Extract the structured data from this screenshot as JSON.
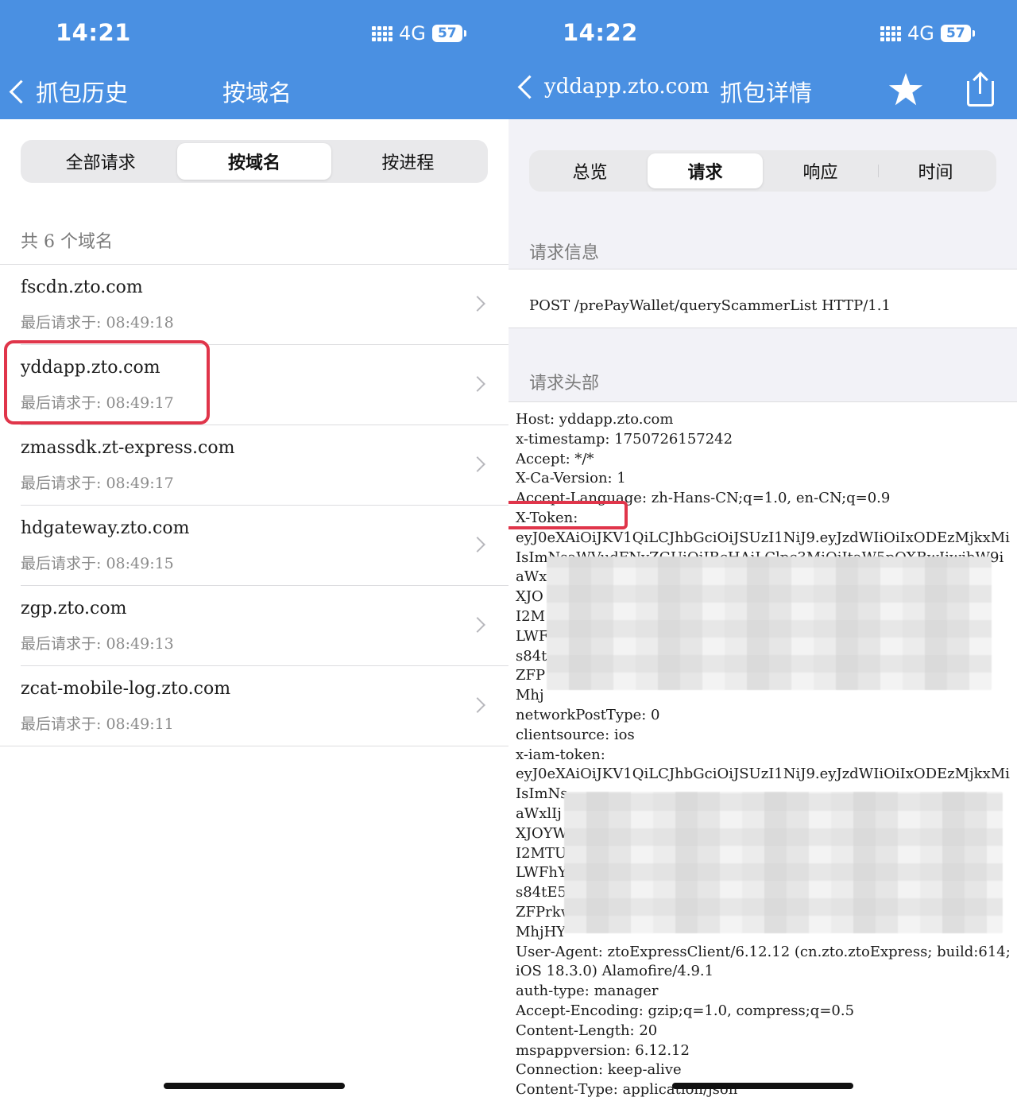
{
  "left": {
    "status": {
      "time": "14:21",
      "network": "4G",
      "battery": "57"
    },
    "nav": {
      "back_label": "抓包历史",
      "title": "按域名"
    },
    "segments": [
      "全部请求",
      "按域名",
      "按进程"
    ],
    "segment_active": "按域名",
    "count_label": "共 6 个域名",
    "domains": [
      {
        "name": "fscdn.zto.com",
        "last": "最后请求于: 08:49:18"
      },
      {
        "name": "yddapp.zto.com",
        "last": "最后请求于: 08:49:17"
      },
      {
        "name": "zmassdk.zt-express.com",
        "last": "最后请求于: 08:49:17"
      },
      {
        "name": "hdgateway.zto.com",
        "last": "最后请求于: 08:49:15"
      },
      {
        "name": "zgp.zto.com",
        "last": "最后请求于: 08:49:13"
      },
      {
        "name": "zcat-mobile-log.zto.com",
        "last": "最后请求于: 08:49:11"
      }
    ]
  },
  "right": {
    "status": {
      "time": "14:22",
      "network": "4G",
      "battery": "57"
    },
    "nav": {
      "back_label": "yddapp.zto.com",
      "title": "抓包详情"
    },
    "icons": {
      "favorite": "star-icon",
      "share": "share-icon"
    },
    "segments": [
      "总览",
      "请求",
      "响应",
      "时间"
    ],
    "segment_active": "请求",
    "request_info_label": "请求信息",
    "request_line": "POST /prePayWallet/queryScammerList HTTP/1.1",
    "request_headers_label": "请求头部",
    "header_lines": [
      "Host: yddapp.zto.com",
      "x-timestamp: 1750726157242",
      "Accept: */*",
      "X-Ca-Version: 1",
      "Accept-Language: zh-Hans-CN;q=1.0, en-CN;q=0.9",
      "X-Token:",
      "eyJ0eXAiOiJKV1QiLCJhbGciOiJSUzI1NiJ9.eyJzdWIiOiIxODEzMjkxMi",
      "IsImNsaWVudFNyZGUiOiIBcHAiLClpc3MiOiItaW5pOXBwIiwibW9i",
      "aWx",
      "XJO",
      "I2M",
      "LWF",
      "s84t",
      "ZFP",
      "Mhj",
      "networkPostType: 0",
      "clientsource: ios",
      "x-iam-token:",
      "eyJ0eXAiOiJKV1QiLCJhbGciOiJSUzI1NiJ9.eyJzdWIiOiIxODEzMjkxMi",
      "IsImNs",
      "aWxlIj",
      "XJOYW",
      "I2MTU",
      "LWFhY",
      "s84tE5",
      "ZFPrkw",
      "MhjHY",
      "User-Agent: ztoExpressClient/6.12.12 (cn.zto.ztoExpress; build:614;",
      "iOS 18.3.0) Alamofire/4.9.1",
      "auth-type: manager",
      "Accept-Encoding: gzip;q=1.0, compress;q=0.5",
      "Content-Length: 20",
      "mspappversion: 6.12.12",
      "Connection: keep-alive",
      "Content-Type: application/json"
    ]
  },
  "colors": {
    "nav_blue": "#4a90e2",
    "highlight_red": "#e0354a"
  }
}
